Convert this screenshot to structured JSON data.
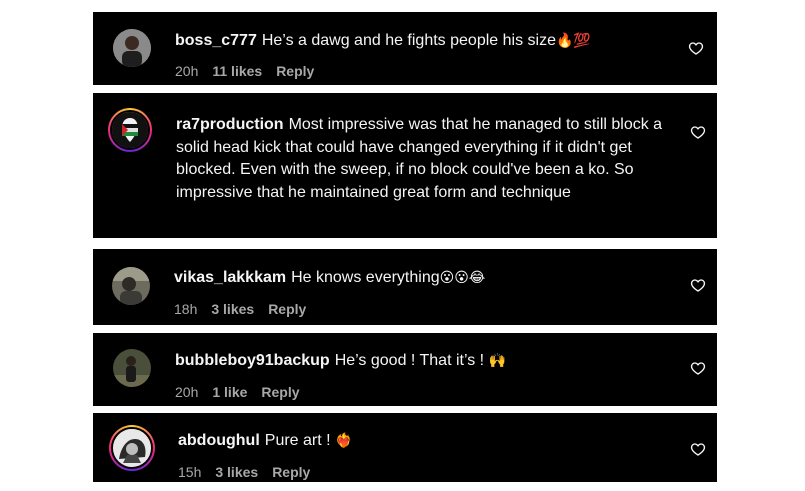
{
  "comments": [
    {
      "username": "boss_c777",
      "text": "He’s a dawg and he fights people his size",
      "emoji": "🔥💯",
      "time": "20h",
      "likes": "11 likes",
      "reply": "Reply"
    },
    {
      "username": "ra7production",
      "text": "Most impressive was that he managed to still block a solid head kick that could have changed everything if it didn't get blocked. Even with the sweep, if no block could've been a ko. So impressive that he maintained great form and technique",
      "emoji": "",
      "time": "",
      "likes": "",
      "reply": ""
    },
    {
      "username": "vikas_lakkkam",
      "text": "He knows everything",
      "emoji": "😮😮😂",
      "time": "18h",
      "likes": "3 likes",
      "reply": "Reply"
    },
    {
      "username": "bubbleboy91backup",
      "text": "He’s good ! That it’s !",
      "emoji": "🙌",
      "time": "20h",
      "likes": "1 like",
      "reply": "Reply"
    },
    {
      "username": "abdoughul",
      "text": "Pure art !",
      "emoji": "❤️‍🔥",
      "time": "15h",
      "likes": "3 likes",
      "reply": "Reply"
    }
  ],
  "icons": {
    "like": "heart-outline-icon"
  },
  "colors": {
    "card_bg": "#000000",
    "text": "#f5f5f5",
    "meta": "#a8a8a8",
    "story_ring": [
      "#f9ce34",
      "#ee2a7b",
      "#6228d7"
    ]
  }
}
